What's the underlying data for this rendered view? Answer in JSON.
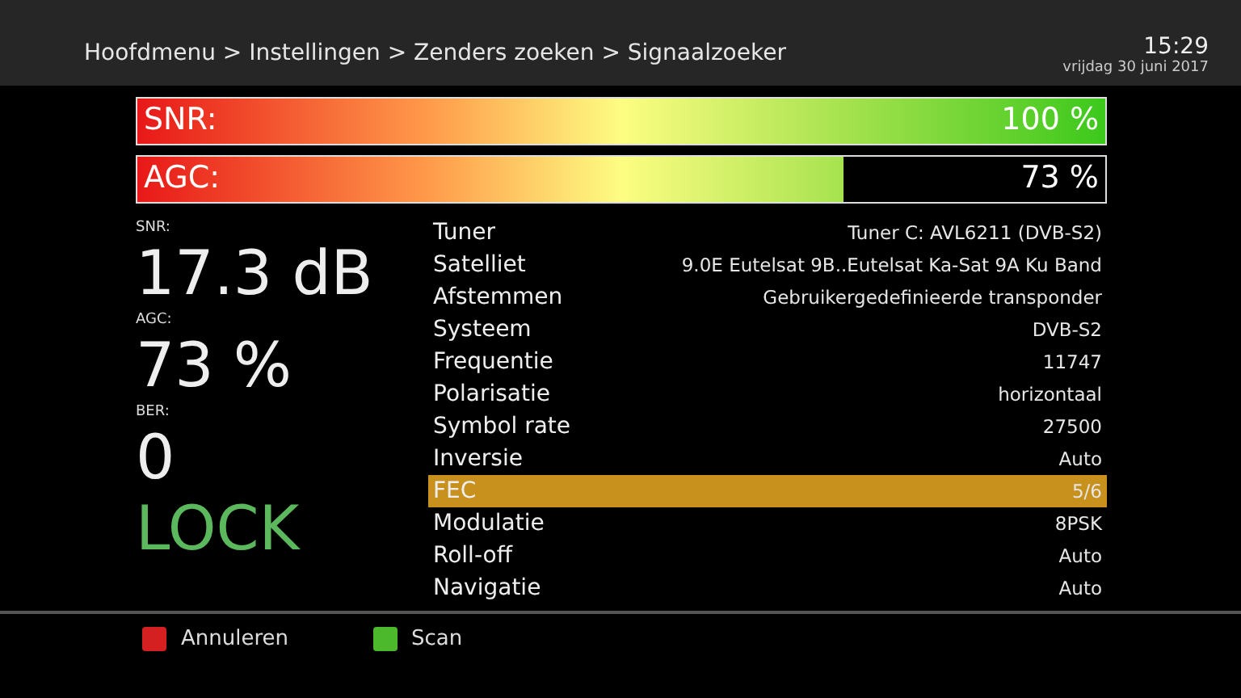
{
  "header": {
    "breadcrumb": "Hoofdmenu > Instellingen > Zenders zoeken > Signaalzoeker",
    "time": "15:29",
    "date": "vrijdag 30 juni 2017"
  },
  "meters": [
    {
      "label": "SNR:",
      "level": 1.0,
      "reading": "100 %"
    },
    {
      "label": "AGC:",
      "level": 0.73,
      "reading": "73 %"
    }
  ],
  "readouts": [
    {
      "label": "SNR:",
      "value": "17.3 dB",
      "kind": "plain"
    },
    {
      "label": "AGC:",
      "value": "73 %",
      "kind": "plain"
    },
    {
      "label": "BER:",
      "value": "0",
      "kind": "plain"
    },
    {
      "value": "LOCK",
      "kind": "status"
    }
  ],
  "details": [
    {
      "name": "Tuner",
      "value": "Tuner C: AVL6211 (DVB-S2)",
      "selected": false
    },
    {
      "name": "Satelliet",
      "value": "9.0E Eutelsat 9B..Eutelsat Ka-Sat 9A Ku Band",
      "selected": false
    },
    {
      "name": "Afstemmen",
      "value": "Gebruikergedefinieerde transponder",
      "selected": false
    },
    {
      "name": "Systeem",
      "value": "DVB-S2",
      "selected": false
    },
    {
      "name": "Frequentie",
      "value": "11747",
      "selected": false
    },
    {
      "name": "Polarisatie",
      "value": "horizontaal",
      "selected": false
    },
    {
      "name": "Symbol rate",
      "value": "27500",
      "selected": false
    },
    {
      "name": "Inversie",
      "value": "Auto",
      "selected": false
    },
    {
      "name": "FEC",
      "value": "5/6",
      "selected": true
    },
    {
      "name": "Modulatie",
      "value": "8PSK",
      "selected": false
    },
    {
      "name": "Roll-off",
      "value": "Auto",
      "selected": false
    },
    {
      "name": "Navigatie",
      "value": "Auto",
      "selected": false
    }
  ],
  "buttons": [
    {
      "label": "Annuleren",
      "color": "#d42020"
    },
    {
      "label": "Scan",
      "color": "#4cb82c"
    }
  ]
}
